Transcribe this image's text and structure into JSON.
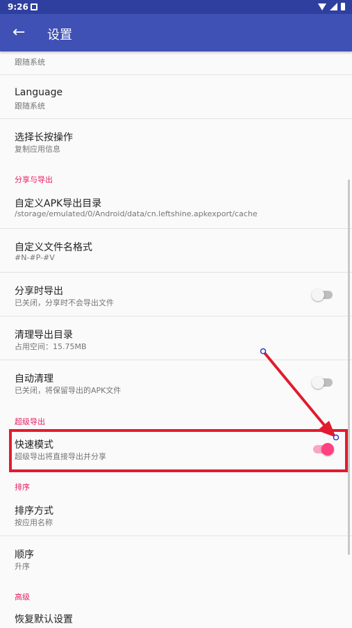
{
  "status_bar": {
    "time": "9:26"
  },
  "app_bar": {
    "title": "设置"
  },
  "partial_item": {
    "subtitle": "跟随系统"
  },
  "items": {
    "language": {
      "title": "Language",
      "subtitle": "跟随系统"
    },
    "long_press": {
      "title": "选择长按操作",
      "subtitle": "复制应用信息"
    },
    "export_dir": {
      "title": "自定义APK导出目录",
      "subtitle": "/storage/emulated/0/Android/data/cn.leftshine.apkexport/cache"
    },
    "filename_format": {
      "title": "自定义文件名格式",
      "subtitle": "#N-#P-#V"
    },
    "export_on_share": {
      "title": "分享时导出",
      "subtitle": "已关闭，分享时不会导出文件",
      "enabled": false
    },
    "clean_dir": {
      "title": "清理导出目录",
      "subtitle": "占用空间：15.75MB"
    },
    "auto_clean": {
      "title": "自动清理",
      "subtitle": "已关闭，将保留导出的APK文件",
      "enabled": false
    },
    "fast_mode": {
      "title": "快速模式",
      "subtitle": "超级导出将直接导出并分享",
      "enabled": true
    },
    "sort_by": {
      "title": "排序方式",
      "subtitle": "按应用名称"
    },
    "order": {
      "title": "顺序",
      "subtitle": "升序"
    },
    "restore_defaults": {
      "title": "恢复默认设置"
    }
  },
  "categories": {
    "share_export": "分享与导出",
    "super_export": "超级导出",
    "sort": "排序",
    "advanced": "高级"
  },
  "colors": {
    "status_bar": "#2f3fa0",
    "app_bar": "#3f51b5",
    "accent": "#e91e63",
    "annotation": "#e21b2e"
  }
}
